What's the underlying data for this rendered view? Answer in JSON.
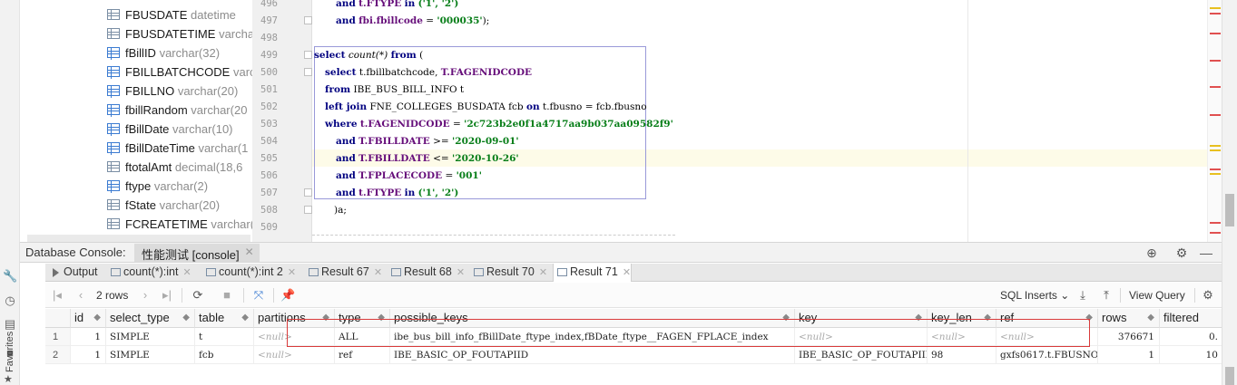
{
  "tree": {
    "items": [
      {
        "name": "FBUSDATE",
        "type": "datetime",
        "key": false
      },
      {
        "name": "FBUSDATETIME",
        "type": "varchar",
        "key": false
      },
      {
        "name": "fBillID",
        "type": "varchar(32)",
        "key": true
      },
      {
        "name": "FBILLBATCHCODE",
        "type": "varch",
        "key": true
      },
      {
        "name": "FBILLNO",
        "type": "varchar(20)",
        "key": true
      },
      {
        "name": "fbillRandom",
        "type": "varchar(20",
        "key": true
      },
      {
        "name": "fBillDate",
        "type": "varchar(10)",
        "key": true
      },
      {
        "name": "fBillDateTime",
        "type": "varchar(1",
        "key": true
      },
      {
        "name": "ftotalAmt",
        "type": "decimal(18,6",
        "key": false
      },
      {
        "name": "ftype",
        "type": "varchar(2)",
        "key": true
      },
      {
        "name": "fState",
        "type": "varchar(20)",
        "key": false
      },
      {
        "name": "FCREATETIME",
        "type": "varchar(1",
        "key": false
      }
    ]
  },
  "editor": {
    "line_numbers": [
      "496",
      "497",
      "498",
      "499",
      "500",
      "501",
      "502",
      "503",
      "504",
      "505",
      "506",
      "507",
      "508",
      "509"
    ],
    "lines": {
      "l496": {
        "kw1": "and",
        "fld": "t.FTYPE",
        "kw2": "in",
        "rest": "('1', '2')"
      },
      "l497": {
        "kw1": "and",
        "fld": "fbi.fbillcode",
        "op": "=",
        "str": "'000035'",
        "end": ");"
      },
      "l499": {
        "kw1": "select",
        "fn": "count(*)",
        "kw2": "from",
        "end": "("
      },
      "l500": {
        "kw1": "select",
        "a": "t.fbillbatchcode,",
        "fld": "T.FAGENIDCODE"
      },
      "l501": {
        "kw1": "from",
        "a": "IBE_BUS_BILL_INFO t"
      },
      "l502": {
        "kw1": "left join",
        "a": "FNE_COLLEGES_BUSDATA fcb",
        "kw2": "on",
        "b": "t.fbusno = fcb.fbusno"
      },
      "l503": {
        "kw1": "where",
        "fld": "t.FAGENIDCODE",
        "op": "=",
        "str": "'2c723b2e0f1a4717aa9b037aa09582f9'"
      },
      "l504": {
        "kw1": "and",
        "fld": "T.FBILLDATE",
        "op": ">=",
        "str": "'2020-09-01'"
      },
      "l505": {
        "kw1": "and",
        "fld": "T.FBILLDATE",
        "op": "<=",
        "str": "'2020-10-26'"
      },
      "l506": {
        "kw1": "and",
        "fld": "T.FPLACECODE",
        "op": "=",
        "str": "'001'"
      },
      "l507": {
        "kw1": "and",
        "fld": "t.FTYPE",
        "kw2": "in",
        "rest": "('1', '2')"
      },
      "l508": {
        "end": ")a;"
      }
    }
  },
  "console": {
    "title": "Database Console:",
    "tab_label": "性能测试 [console]"
  },
  "result_tabs": [
    {
      "label": "Output",
      "closable": false,
      "active": false
    },
    {
      "label": "count(*):int",
      "closable": true,
      "active": false
    },
    {
      "label": "count(*):int 2",
      "closable": true,
      "active": false
    },
    {
      "label": "Result 67",
      "closable": true,
      "active": false
    },
    {
      "label": "Result 68",
      "closable": true,
      "active": false
    },
    {
      "label": "Result 70",
      "closable": true,
      "active": false
    },
    {
      "label": "Result 71",
      "closable": true,
      "active": true
    }
  ],
  "toolbar": {
    "rows_label": "2 rows",
    "sql_inserts": "SQL Inserts",
    "view_query": "View Query"
  },
  "grid": {
    "columns": [
      "id",
      "select_type",
      "table",
      "partitions",
      "type",
      "possible_keys",
      "key",
      "key_len",
      "ref",
      "rows",
      "filtered"
    ],
    "rows": [
      {
        "rownum": "1",
        "id": "1",
        "select_type": "SIMPLE",
        "table": "t",
        "partitions": "<null>",
        "type": "ALL",
        "possible_keys": "ibe_bus_bill_info_fBillDate_ftype_index,fBDate_ftype__FAGEN_FPLACE_index",
        "key": "<null>",
        "key_len": "<null>",
        "ref": "<null>",
        "rows": "376671",
        "filtered": "0."
      },
      {
        "rownum": "2",
        "id": "1",
        "select_type": "SIMPLE",
        "table": "fcb",
        "partitions": "<null>",
        "type": "ref",
        "possible_keys": "IBE_BASIC_OP_FOUTAPIID",
        "key": "IBE_BASIC_OP_FOUTAPIID",
        "key_len": "98",
        "ref": "gxfs0617.t.FBUSNO",
        "rows": "1",
        "filtered": "10"
      }
    ]
  },
  "sidebar": {
    "favorites_label": "Favorites"
  },
  "colors": {
    "keyword": "#000080",
    "string": "#067d17",
    "field": "#660e7a",
    "highlight_box": "#d93a3a",
    "selection_box": "#9999d9"
  }
}
